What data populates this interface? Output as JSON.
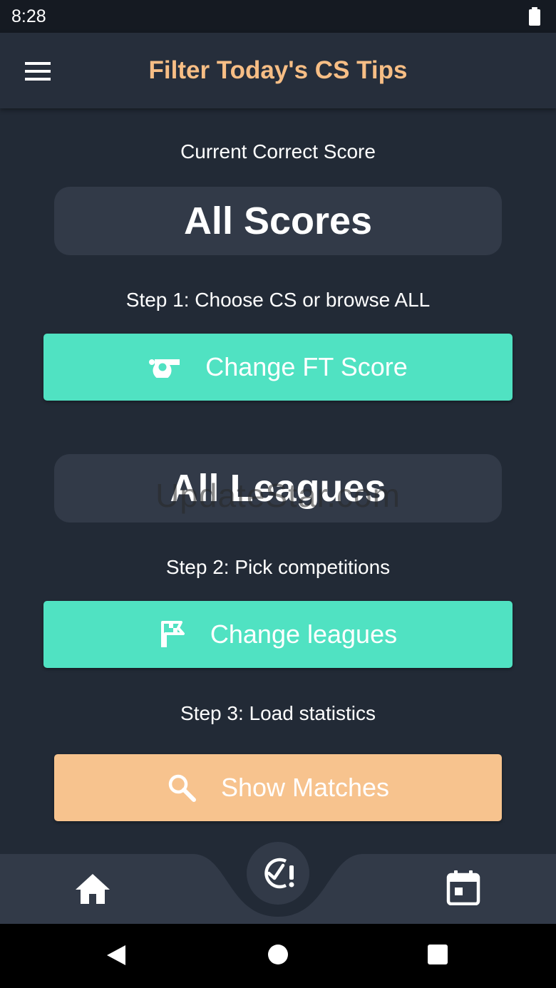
{
  "status_bar": {
    "time": "8:28"
  },
  "app_bar": {
    "title": "Filter Today's CS Tips"
  },
  "score_section": {
    "caption": "Current Correct Score",
    "value": "All Scores",
    "step_text": "Step 1: Choose CS or browse ALL",
    "button_label": "Change FT Score"
  },
  "league_section": {
    "value": "All Leagues",
    "step_text": "Step 2: Pick competitions",
    "button_label": "Change leagues"
  },
  "load_section": {
    "step_text": "Step 3: Load statistics",
    "button_label": "Show Matches"
  },
  "watermark": "UpdateStar.com",
  "colors": {
    "background": "#222a36",
    "title_accent": "#f7be85",
    "teal_button": "#50e2c2",
    "orange_button": "#f7c38e"
  },
  "icons": {
    "menu": "hamburger-icon",
    "score_button": "whistle-icon",
    "leagues_button": "flag-icon",
    "show_button": "search-icon",
    "nav_home": "home-icon",
    "nav_center": "clock-alert-icon",
    "nav_calendar": "calendar-icon"
  }
}
